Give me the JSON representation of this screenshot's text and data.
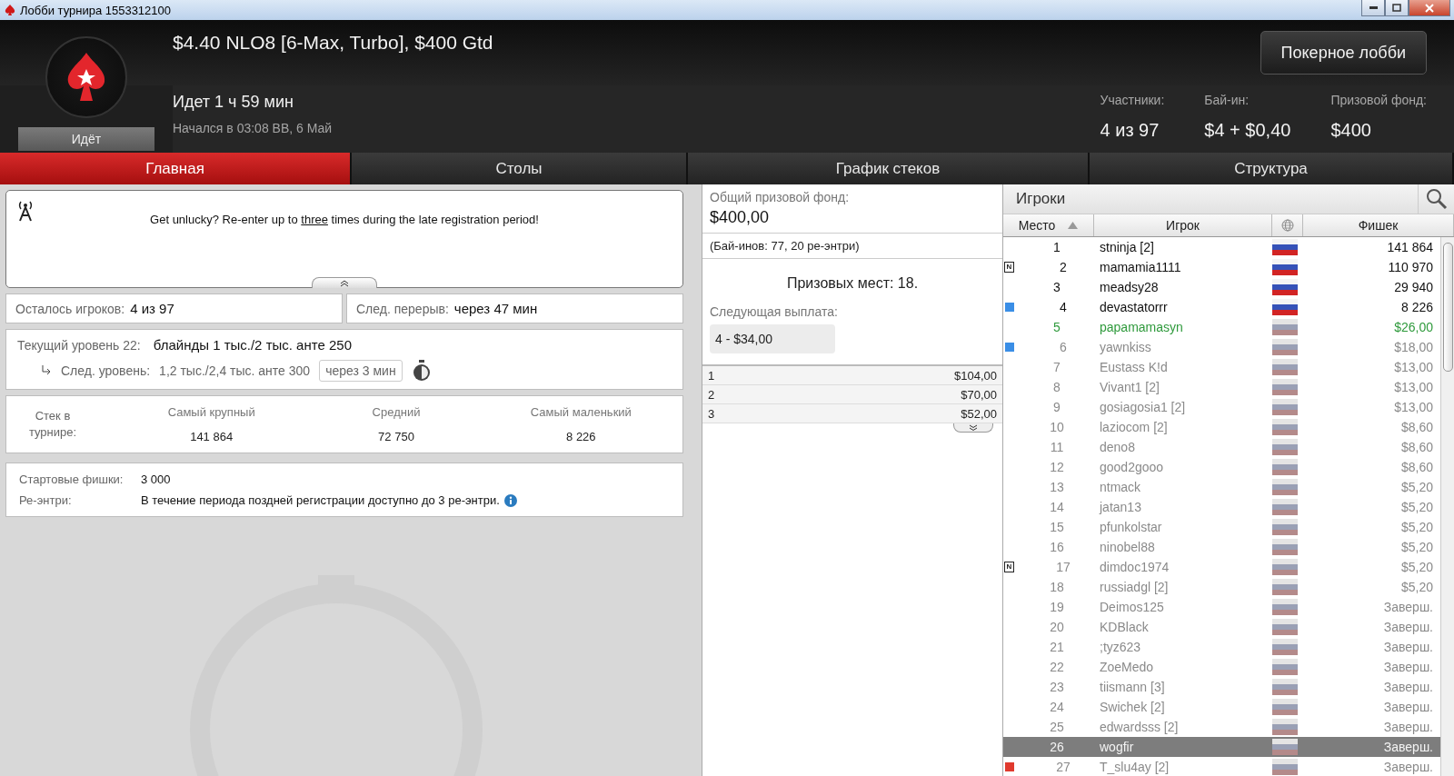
{
  "window": {
    "title": "Лобби турнира 1553312100"
  },
  "header": {
    "title": "$4.40 NLO8 [6-Max, Turbo], $400 Gtd",
    "status_badge": "Идёт",
    "elapsed": "Идет 1 ч 59 мин",
    "started": "Начался в 03:08 ВВ, 6 Май",
    "lobby_button": "Покерное лобби",
    "stats": [
      {
        "label": "Участники:",
        "value": "4 из 97"
      },
      {
        "label": "Бай-ин:",
        "value": "$4 + $0,40"
      },
      {
        "label": "Призовой фонд:",
        "value": "$400"
      }
    ]
  },
  "tabs": [
    {
      "label": "Главная",
      "selected": true
    },
    {
      "label": "Столы",
      "selected": false
    },
    {
      "label": "График стеков",
      "selected": false
    },
    {
      "label": "Структура",
      "selected": false
    }
  ],
  "news": {
    "before": "Get unlucky? Re-enter up to",
    "link": "three",
    "after": "times during the late registration period!"
  },
  "summary": [
    {
      "label": "Осталось игроков:",
      "value": "4 из 97"
    },
    {
      "label": "След. перерыв:",
      "value": "через 47 мин"
    }
  ],
  "level": {
    "current_label": "Текущий уровень 22:",
    "current_value": "блайнды 1 тыс./2 тыс. анте 250",
    "next_label": "След. уровень:",
    "next_value": "1,2 тыс./2,4 тыс. анте 300",
    "countdown": "через 3 мин"
  },
  "stacks": {
    "label": "Стек в турнире:",
    "columns": [
      {
        "label": "Самый крупный",
        "value": "141 864"
      },
      {
        "label": "Средний",
        "value": "72 750"
      },
      {
        "label": "Самый маленький",
        "value": "8 226"
      }
    ]
  },
  "info": [
    {
      "label": "Стартовые фишки:",
      "value": "3 000",
      "info_icon": false
    },
    {
      "label": "Ре-энтри:",
      "value": "В течение периода поздней регистрации доступно до 3 ре-энтри.",
      "info_icon": true
    }
  ],
  "prize": {
    "total_label": "Общий призовой фонд:",
    "total": "$400,00",
    "entries": "(Бай-инов: 77, 20 ре-энтри)",
    "places": "Призовых мест: 18.",
    "next_label": "Следующая выплата:",
    "next_value": "4 - $34,00",
    "payouts": [
      {
        "place": "1",
        "amount": "$104,00"
      },
      {
        "place": "2",
        "amount": "$70,00"
      },
      {
        "place": "3",
        "amount": "$52,00"
      }
    ]
  },
  "players": {
    "title": "Игроки",
    "columns": [
      {
        "kind": "text",
        "label": "Место",
        "sorted": true
      },
      {
        "kind": "text",
        "label": "Игрок",
        "sorted": false
      },
      {
        "kind": "country",
        "sorted": false
      },
      {
        "kind": "text",
        "label": "Фишек",
        "sorted": false
      }
    ],
    "rows": [
      {
        "place": "1",
        "name": "stninja [2]",
        "chips": "141 864",
        "kind": "active",
        "selected": false
      },
      {
        "place": "2",
        "name": "mamamia1111",
        "chips": "110 970",
        "kind": "active",
        "selected": false,
        "badge": "N"
      },
      {
        "place": "3",
        "name": "meadsy28",
        "chips": "29 940",
        "kind": "active",
        "selected": false
      },
      {
        "place": "4",
        "name": "devastatorrr",
        "chips": "8 226",
        "kind": "active",
        "selected": false,
        "color": "#3a8ee6"
      },
      {
        "place": "5",
        "name": "papamamasyn",
        "chips": "$26,00",
        "kind": "prize",
        "selected": false
      },
      {
        "place": "6",
        "name": "yawnkiss",
        "chips": "$18,00",
        "kind": "out",
        "selected": false,
        "color": "#3a8ee6"
      },
      {
        "place": "7",
        "name": "Eustass K!d",
        "chips": "$13,00",
        "kind": "out",
        "selected": false
      },
      {
        "place": "8",
        "name": "Vivant1 [2]",
        "chips": "$13,00",
        "kind": "out",
        "selected": false
      },
      {
        "place": "9",
        "name": "gosiagosia1 [2]",
        "chips": "$13,00",
        "kind": "out",
        "selected": false
      },
      {
        "place": "10",
        "name": "laziocom [2]",
        "chips": "$8,60",
        "kind": "out",
        "selected": false
      },
      {
        "place": "11",
        "name": "deno8",
        "chips": "$8,60",
        "kind": "out",
        "selected": false
      },
      {
        "place": "12",
        "name": "good2gooo",
        "chips": "$8,60",
        "kind": "out",
        "selected": false
      },
      {
        "place": "13",
        "name": "ntmack",
        "chips": "$5,20",
        "kind": "out",
        "selected": false
      },
      {
        "place": "14",
        "name": "jatan13",
        "chips": "$5,20",
        "kind": "out",
        "selected": false
      },
      {
        "place": "15",
        "name": "pfunkolstar",
        "chips": "$5,20",
        "kind": "out",
        "selected": false
      },
      {
        "place": "16",
        "name": "ninobel88",
        "chips": "$5,20",
        "kind": "out",
        "selected": false
      },
      {
        "place": "17",
        "name": "dimdoc1974",
        "chips": "$5,20",
        "kind": "out",
        "selected": false,
        "badge": "N"
      },
      {
        "place": "18",
        "name": "russiadgl [2]",
        "chips": "$5,20",
        "kind": "out",
        "selected": false
      },
      {
        "place": "19",
        "name": "Deimos125",
        "chips": "Заверш.",
        "kind": "out",
        "selected": false
      },
      {
        "place": "20",
        "name": "KDBlack",
        "chips": "Заверш.",
        "kind": "out",
        "selected": false
      },
      {
        "place": "21",
        "name": ";tyz623",
        "chips": "Заверш.",
        "kind": "out",
        "selected": false
      },
      {
        "place": "22",
        "name": "ZoeMedo",
        "chips": "Заверш.",
        "kind": "out",
        "selected": false
      },
      {
        "place": "23",
        "name": "tiismann [3]",
        "chips": "Заверш.",
        "kind": "out",
        "selected": false
      },
      {
        "place": "24",
        "name": "Swichek [2]",
        "chips": "Заверш.",
        "kind": "out",
        "selected": false
      },
      {
        "place": "25",
        "name": "edwardsss [2]",
        "chips": "Заверш.",
        "kind": "out",
        "selected": false
      },
      {
        "place": "26",
        "name": "wogfir",
        "chips": "Заверш.",
        "kind": "out",
        "selected": true
      },
      {
        "place": "27",
        "name": "T_slu4ay [2]",
        "chips": "Заверш.",
        "kind": "out",
        "selected": false,
        "color": "#e03a2e"
      }
    ]
  }
}
